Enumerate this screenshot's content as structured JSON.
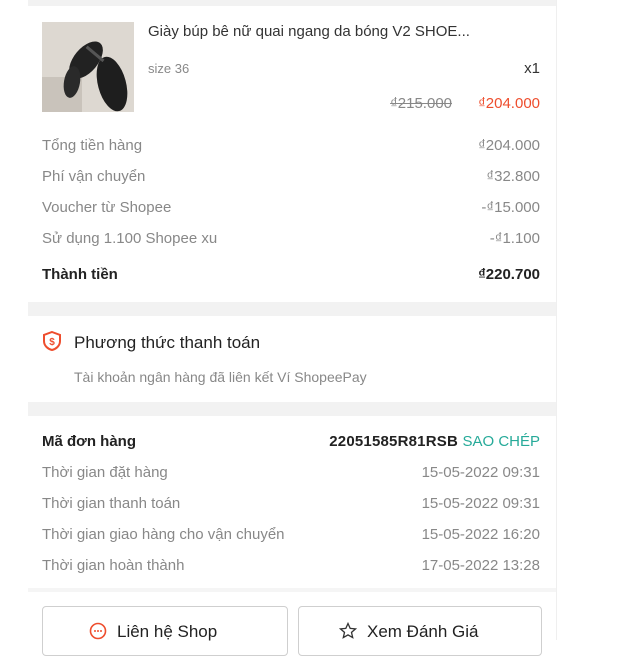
{
  "product": {
    "name": "Giày búp bê nữ quai ngang da bóng V2 SHOE...",
    "variant": "size 36",
    "quantity": "x1",
    "price_original": "₫215.000",
    "price_sale": "₫204.000",
    "image_icon": "shoe-product-image"
  },
  "summary": [
    {
      "label": "Tổng tiền hàng",
      "value": "₫204.000"
    },
    {
      "label": "Phí vận chuyển",
      "value": "₫32.800"
    },
    {
      "label": "Voucher từ Shopee",
      "value": "-₫15.000"
    },
    {
      "label": "Sử dụng 1.100 Shopee xu",
      "value": "-₫1.100"
    }
  ],
  "total": {
    "label": "Thành tiền",
    "value": "₫220.700"
  },
  "payment": {
    "icon": "shield-payment-icon",
    "title": "Phương thức thanh toán",
    "description": "Tài khoản ngân hàng đã liên kết Ví ShopeePay"
  },
  "order": {
    "label": "Mã đơn hàng",
    "id": "22051585R81RSB",
    "copy_label": "SAO CHÉP",
    "times": [
      {
        "label": "Thời gian đặt hàng",
        "value": "15-05-2022 09:31"
      },
      {
        "label": "Thời gian thanh toán",
        "value": "15-05-2022 09:31"
      },
      {
        "label": "Thời gian giao hàng cho vận chuyển",
        "value": "15-05-2022 16:20"
      },
      {
        "label": "Thời gian hoàn thành",
        "value": "17-05-2022 13:28"
      }
    ]
  },
  "actions": {
    "contact_shop": "Liên hệ Shop",
    "contact_icon": "chat-icon",
    "view_rating": "Xem Đánh Giá",
    "rating_icon": "star-icon"
  },
  "colors": {
    "accent": "#ee4d2d",
    "copy": "#26aa99",
    "muted": "#888888"
  }
}
